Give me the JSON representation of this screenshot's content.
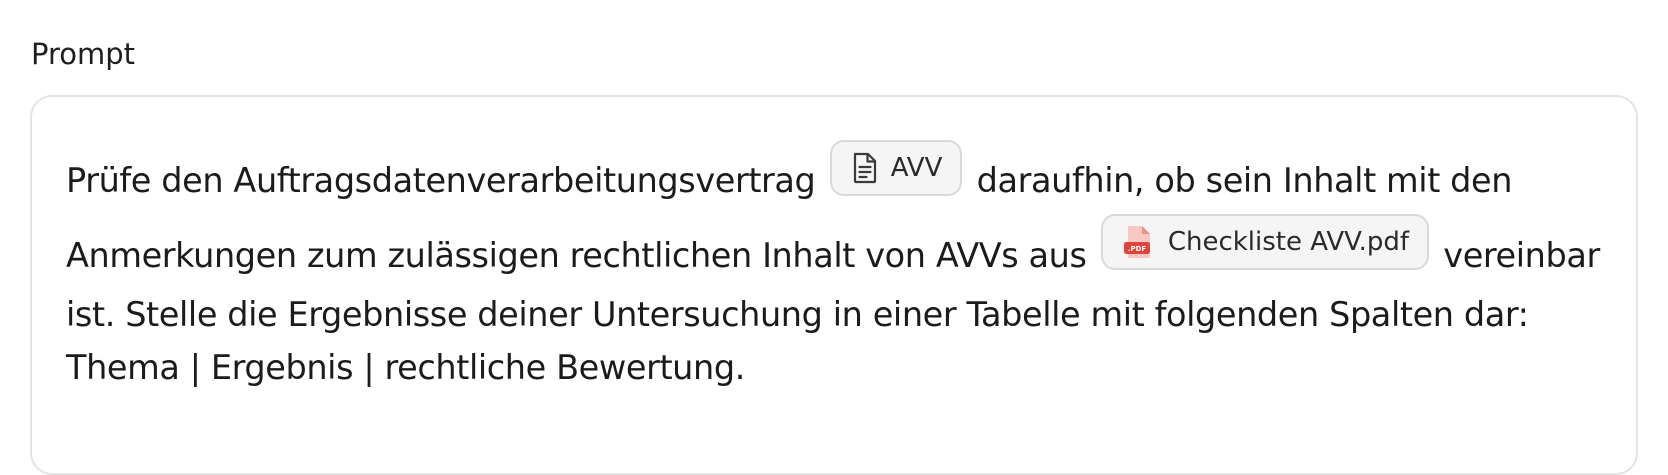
{
  "section": {
    "label": "Prompt"
  },
  "prompt": {
    "line1_before": "Prüfe den Auftragsdatenverarbeitungsvertrag",
    "chip1": {
      "label": "AVV",
      "icon": "document-icon"
    },
    "line1_after": "daraufhin, ob sein Inhalt mit den",
    "line2_before": "Anmerkungen zum zulässigen rechtlichen Inhalt von AVVs aus",
    "chip2": {
      "label": "Checkliste AVV.pdf",
      "icon": "pdf-file-icon",
      "icon_badge": ".PDF"
    },
    "line2_after": "vereinbar",
    "line3": "ist. Stelle die Ergebnisse deiner Untersuchung in einer Tabelle mit folgenden Spalten dar:",
    "line4": "Thema | Ergebnis | rechtliche Bewertung."
  },
  "colors": {
    "chip_background": "#f5f5f5",
    "chip_border": "#d9d9d9",
    "box_border": "#e3e3e3",
    "pdf_red": "#e0443b",
    "pdf_pink": "#f6c7c3"
  }
}
